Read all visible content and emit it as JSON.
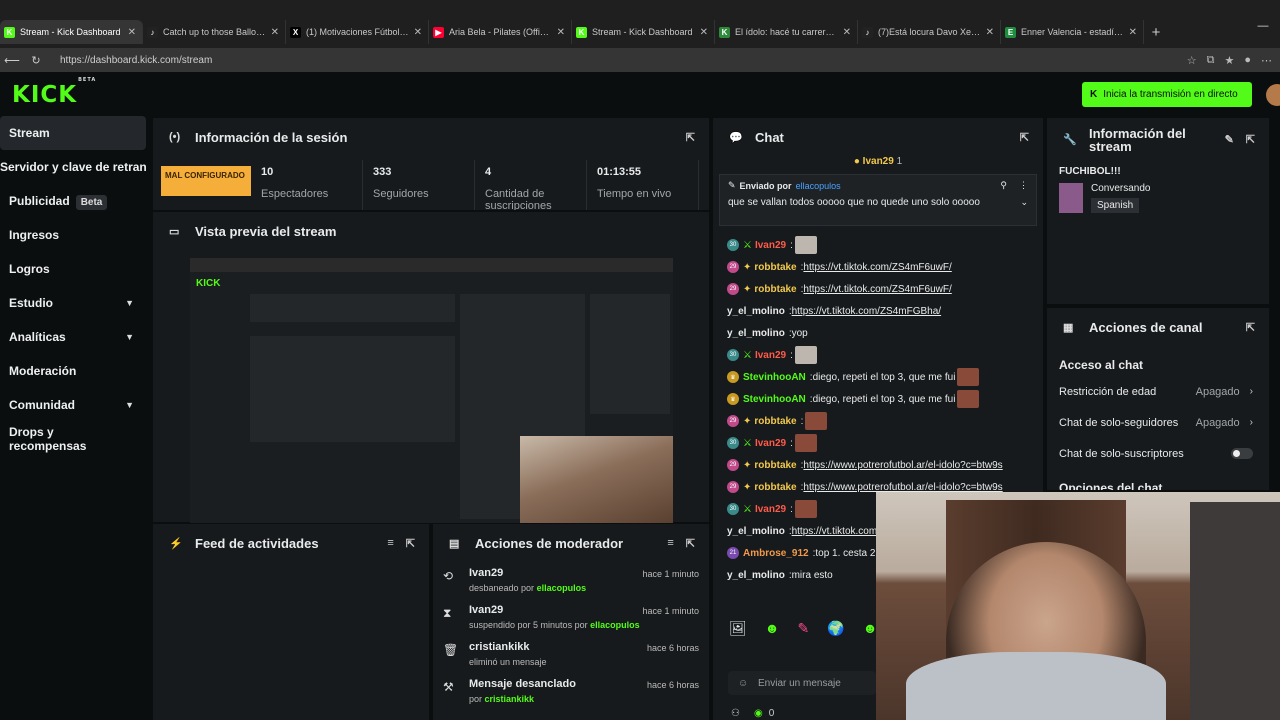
{
  "browser": {
    "tabs": [
      {
        "label": "Stream - Kick Dashboard",
        "fav": "K",
        "fav_color": "#53fc18",
        "active": true
      },
      {
        "label": "Catch up to those Ballon D'o",
        "fav": "♪",
        "fav_color": "#222222",
        "active": false
      },
      {
        "label": "(1) Motivaciones Fútbol on X",
        "fav": "X",
        "fav_color": "#000000",
        "active": false
      },
      {
        "label": "Aria Bela - Pilates (Official V",
        "fav": "▶",
        "fav_color": "#ff0033",
        "active": false
      },
      {
        "label": "Stream - Kick Dashboard",
        "fav": "K",
        "fav_color": "#53fc18",
        "active": false
      },
      {
        "label": "El ídolo: hacé tu carrera en e",
        "fav": "K",
        "fav_color": "#2d8a3a",
        "active": false
      },
      {
        "label": "(7)Está locura Davo Xeneize",
        "fav": "♪",
        "fav_color": "#222222",
        "active": false
      },
      {
        "label": "Enner Valencia - estadísticas",
        "fav": "E",
        "fav_color": "#1e8e3e",
        "active": false
      }
    ],
    "new_tab": "+",
    "url": "https://dashboard.kick.com/stream"
  },
  "topnav": {
    "logo": "KICK",
    "logo_badge": "BETA",
    "go_live": "Inicia la transmisión en directo"
  },
  "sidebar": {
    "items": [
      {
        "label": "Stream",
        "active": true,
        "beta": "",
        "chev": ""
      },
      {
        "label": "Servidor y clave de retransm",
        "active": false,
        "beta": "",
        "chev": "",
        "nowrap": true
      },
      {
        "label": "Publicidad",
        "active": false,
        "beta": "Beta",
        "chev": ""
      },
      {
        "label": "Ingresos",
        "active": false,
        "beta": "",
        "chev": ""
      },
      {
        "label": "Logros",
        "active": false,
        "beta": "",
        "chev": ""
      },
      {
        "label": "Estudio",
        "active": false,
        "beta": "",
        "chev": "▼"
      },
      {
        "label": "Analíticas",
        "active": false,
        "beta": "",
        "chev": "▼"
      },
      {
        "label": "Moderación",
        "active": false,
        "beta": "",
        "chev": ""
      },
      {
        "label": "Comunidad",
        "active": false,
        "beta": "",
        "chev": "▼"
      },
      {
        "label": "Drops y recompensas",
        "active": false,
        "beta": "",
        "chev": ""
      }
    ]
  },
  "session": {
    "title": "Información de la sesión",
    "status": "MAL CONFIGURADO",
    "stats": [
      {
        "value": "10",
        "label": "Espectadores"
      },
      {
        "value": "333",
        "label": "Seguidores"
      },
      {
        "value": "4",
        "label": "Cantidad de suscripciones"
      },
      {
        "value": "01:13:55",
        "label": "Tiempo en vivo"
      }
    ]
  },
  "preview": {
    "title": "Vista previa del stream"
  },
  "feed": {
    "title": "Feed de actividades"
  },
  "modactions": {
    "title": "Acciones de moderador",
    "rows": [
      {
        "icon": "⟲",
        "user": "Ivan29",
        "desc": "desbaneado por",
        "by": "ellacopulos",
        "time": "hace 1 minuto"
      },
      {
        "icon": "⧗",
        "user": "Ivan29",
        "desc": "suspendido por 5 minutos por",
        "by": "ellacopulos",
        "time": "hace 1 minuto"
      },
      {
        "icon": "🗑",
        "user": "cristiankikk",
        "desc": "eliminó un mensaje",
        "by": "",
        "time": "hace 6 horas"
      },
      {
        "icon": "⚒",
        "user": "Mensaje desanclado",
        "desc": "por",
        "by": "cristiankikk",
        "time": "hace 6 horas"
      }
    ]
  },
  "chat": {
    "title": "Chat",
    "top_user": "Ivan29",
    "top_count": "1",
    "pinned_label": "Enviado por",
    "pinned_by": "ellacopulos",
    "pinned_text": "que se vallan todos ooooo que no quede uno solo ooooo",
    "messages": [
      {
        "badge": "30",
        "badge_cls": "",
        "user": "Ivan29",
        "color": "#ff5a4a",
        "text": "",
        "link": "",
        "emote": "cat"
      },
      {
        "badge": "29",
        "badge_cls": "pink",
        "user": "robbtake",
        "color": "#f2c94c",
        "text": "",
        "link": "https://vt.tiktok.com/ZS4mF6uwF/",
        "emote": ""
      },
      {
        "badge": "29",
        "badge_cls": "pink",
        "user": "robbtake",
        "color": "#f2c94c",
        "text": "",
        "link": "https://vt.tiktok.com/ZS4mF6uwF/",
        "emote": ""
      },
      {
        "badge": "",
        "badge_cls": "",
        "user": "y_el_molino",
        "color": "#e8eaeb",
        "text": "",
        "link": "https://vt.tiktok.com/ZS4mFGBha/",
        "emote": ""
      },
      {
        "badge": "",
        "badge_cls": "",
        "user": "y_el_molino",
        "color": "#e8eaeb",
        "text": "yop",
        "link": "",
        "emote": ""
      },
      {
        "badge": "30",
        "badge_cls": "",
        "user": "Ivan29",
        "color": "#ff5a4a",
        "text": "",
        "link": "",
        "emote": "cat"
      },
      {
        "badge": "",
        "badge_cls": "gold",
        "user": "StevinhooAN",
        "color": "#53fc18",
        "text": "diego, repeti el top 3, que me fui",
        "link": "",
        "emote": "face"
      },
      {
        "badge": "",
        "badge_cls": "gold",
        "user": "StevinhooAN",
        "color": "#53fc18",
        "text": "diego, repeti el top 3, que me fui",
        "link": "",
        "emote": "face"
      },
      {
        "badge": "29",
        "badge_cls": "pink",
        "user": "robbtake",
        "color": "#f2c94c",
        "text": "",
        "link": "",
        "emote": "face"
      },
      {
        "badge": "30",
        "badge_cls": "",
        "user": "Ivan29",
        "color": "#ff5a4a",
        "text": "",
        "link": "",
        "emote": "face"
      },
      {
        "badge": "29",
        "badge_cls": "pink",
        "user": "robbtake",
        "color": "#f2c94c",
        "text": "",
        "link": "https://www.potrerofutbol.ar/el-idolo?c=btw9s",
        "emote": ""
      },
      {
        "badge": "29",
        "badge_cls": "pink",
        "user": "robbtake",
        "color": "#f2c94c",
        "text": "",
        "link": "https://www.potrerofutbol.ar/el-idolo?c=btw9s",
        "emote": ""
      },
      {
        "badge": "30",
        "badge_cls": "",
        "user": "Ivan29",
        "color": "#ff5a4a",
        "text": "",
        "link": "",
        "emote": "face"
      },
      {
        "badge": "",
        "badge_cls": "",
        "user": "y_el_molino",
        "color": "#e8eaeb",
        "text": "",
        "link": "https://vt.tiktok.com/ZS4mFGBha/",
        "emote": ""
      },
      {
        "badge": "21",
        "badge_cls": "purple",
        "user": "Ambrose_912",
        "color": "#f2994a",
        "text": "top 1. cesta 2.",
        "link": "",
        "emote": ""
      },
      {
        "badge": "",
        "badge_cls": "",
        "user": "y_el_molino",
        "color": "#e8eaeb",
        "text": "mira esto",
        "link": "",
        "emote": ""
      }
    ],
    "input_placeholder": "Enviar un mensaje",
    "bottom_count": "0"
  },
  "streaminfo": {
    "title": "Información del stream",
    "stream_title": "FUCHIBOL!!!",
    "category": "Conversando",
    "language": "Spanish"
  },
  "channel": {
    "title": "Acciones de canal",
    "section": "Acceso al chat",
    "rows": [
      {
        "label": "Restricción de edad",
        "value": "Apagado",
        "type": "select"
      },
      {
        "label": "Chat de solo-seguidores",
        "value": "Apagado",
        "type": "select"
      },
      {
        "label": "Chat de solo-suscriptores",
        "value": "",
        "type": "toggle"
      }
    ],
    "next_section": "Opciones del chat"
  },
  "colors": {
    "brand": "#53fc18",
    "warn": "#f6ae3a"
  }
}
